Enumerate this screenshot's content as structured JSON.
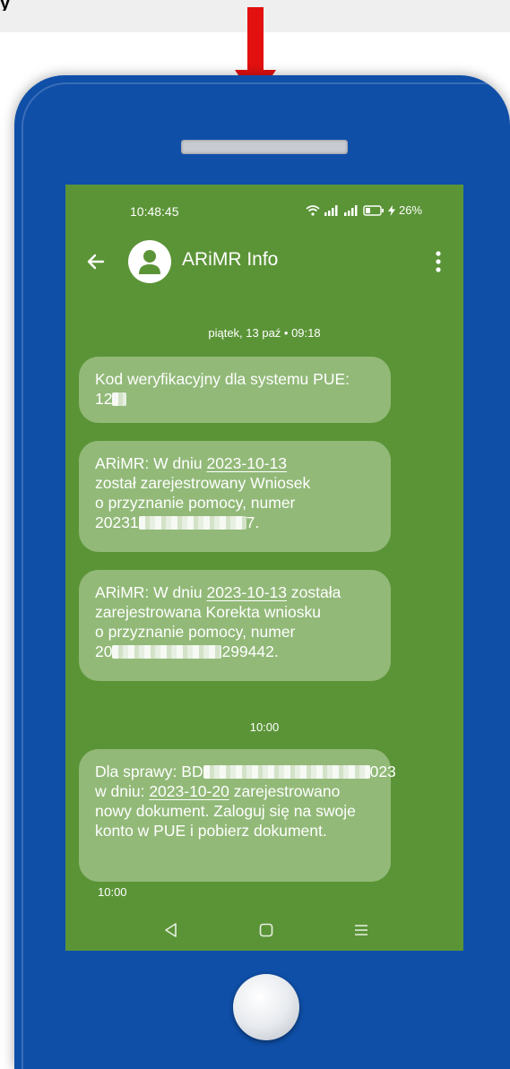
{
  "status_bar": {
    "time": "10:48:45",
    "battery": "26%"
  },
  "header": {
    "contact_name": "ARiMR Info"
  },
  "conversation": {
    "date_separator": "piątek, 13 paź • 09:18",
    "messages": [
      {
        "l1": "Kod weryfikacyjny dla systemu PUE:",
        "l2_prefix": "12"
      },
      {
        "l1_prefix": "ARiMR: W dniu ",
        "date": "2023-10-13",
        "l2": "został zarejestrowany Wniosek",
        "l3": "o przyznanie pomocy, numer",
        "l4_prefix": "20231",
        "l4_suffix": "7."
      },
      {
        "l1_prefix": "ARiMR: W dniu ",
        "date": "2023-10-13",
        "l1_suffix": " została",
        "l2": "zarejestrowana Korekta wniosku",
        "l3": "o przyznanie pomocy, numer",
        "l4_prefix": "20",
        "l4_suffix": "299442."
      },
      {
        "l1_prefix": "Dla sprawy: BD",
        "l1_suffix": "023",
        "l2_prefix": "w dniu: ",
        "date": "2023-10-20",
        "l2_suffix": " zarejestrowano",
        "l3": "nowy dokument. Zaloguj się na swoje",
        "l4": "konto w PUE i pobierz dokument."
      }
    ],
    "time_separator": "10:00",
    "last_message_time": "10:00"
  },
  "colors": {
    "phone_body": "#0f4fa8",
    "screen_background": "#5b9437",
    "bubble_background": "#a8c891",
    "arrow": "#e31010"
  }
}
